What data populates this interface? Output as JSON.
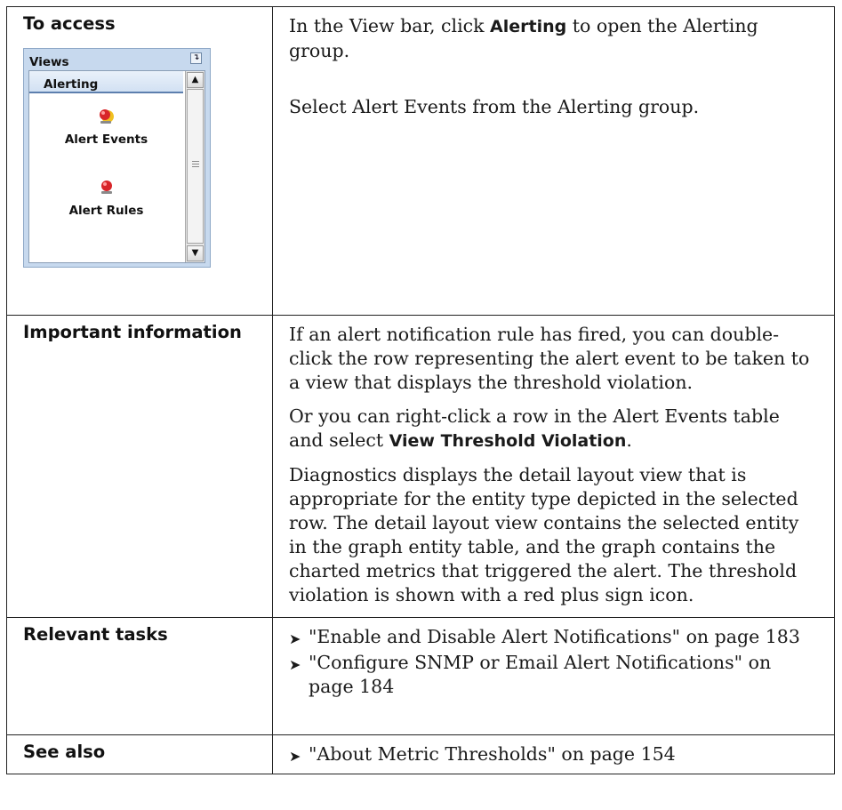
{
  "rows": {
    "access": {
      "label": "To access",
      "para1": {
        "pre": "In the View bar, click ",
        "bold": "Alerting",
        "post": " to open the Alerting group."
      },
      "para2": "Select Alert Events from the Alerting group.",
      "views_panel": {
        "title": "Views",
        "pin_icon": "pin-icon",
        "group": "Alerting",
        "items": [
          {
            "label": "Alert Events",
            "icon": "alert-events-icon"
          },
          {
            "label": "Alert Rules",
            "icon": "alert-rules-icon"
          }
        ]
      }
    },
    "important": {
      "label": "Important information",
      "para1": "If an alert notification rule has fired, you can double-click the row representing the alert event to be taken to a view that displays the threshold violation.",
      "para2": {
        "pre": "Or you can right-click a row in the Alert Events table and select ",
        "bold": "View Threshold Violation",
        "post": "."
      },
      "para3": "Diagnostics displays the detail layout view that is appropriate for the entity type depicted in the selected row. The detail layout view contains the selected entity in the graph entity table, and the graph contains the charted metrics that triggered the alert. The threshold violation is shown with a red plus sign icon."
    },
    "tasks": {
      "label": "Relevant tasks",
      "items": [
        "\"Enable and Disable Alert Notifications\" on page 183",
        "\"Configure SNMP or Email Alert Notifications\" on page 184"
      ]
    },
    "see_also": {
      "label": "See also",
      "items": [
        "\"About Metric Thresholds\" on page 154"
      ]
    }
  },
  "bullet_glyph": "➤"
}
